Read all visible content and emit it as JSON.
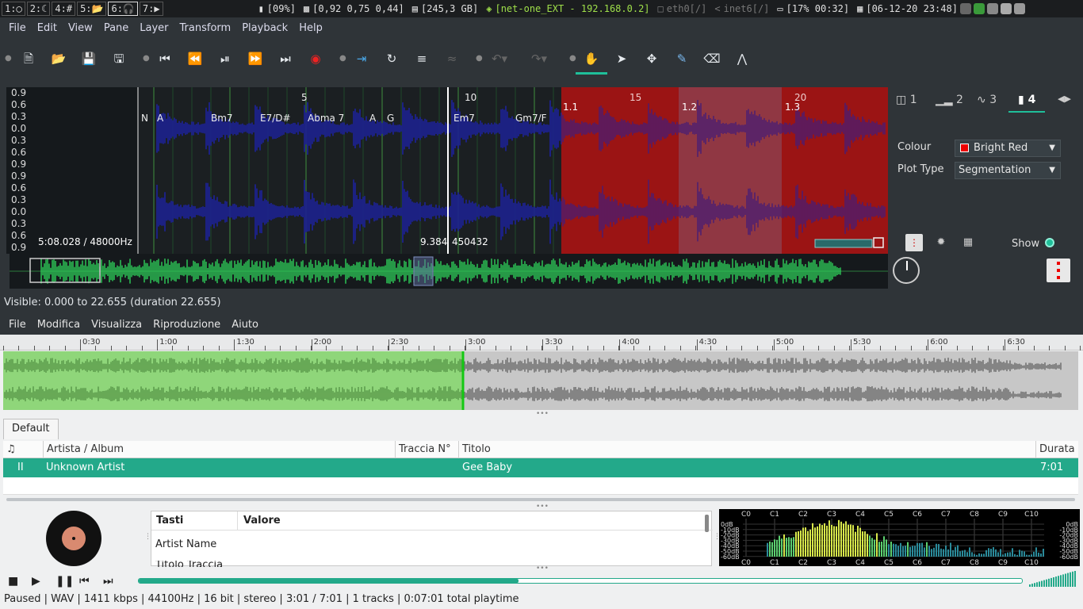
{
  "topbar": {
    "workspaces": [
      "1:",
      "2:",
      "4:#",
      "5:",
      "6:",
      "7:"
    ],
    "battery_pct": "[09%]",
    "load": "[0,92 0,75 0,44]",
    "disk": "[245,3 GB]",
    "wifi": "[net-one_EXT - 192.168.0.2]",
    "eth": "eth0[/]",
    "inet6": "inet6[/]",
    "battery2": "[17% 00:32]",
    "datetime": "[06-12-20 23:48]",
    "colors": {
      "wifi": "#9fe04a",
      "inactive": "#777777"
    }
  },
  "sv": {
    "menu": [
      "File",
      "Edit",
      "View",
      "Pane",
      "Layer",
      "Transform",
      "Playback",
      "Help"
    ],
    "toolbar_icons": [
      "new-file-icon",
      "open-folder-icon",
      "save-icon",
      "save-as-icon",
      "rewind-start-icon",
      "rewind-icon",
      "play-pause-icon",
      "fast-forward-icon",
      "forward-end-icon",
      "record-icon",
      "play-selection-icon",
      "loop-icon",
      "solo-icon",
      "align-icon",
      "undo-icon",
      "redo-icon",
      "navigate-icon",
      "select-icon",
      "move-icon",
      "draw-icon",
      "erase-icon",
      "measure-icon"
    ],
    "y_ticks_top": [
      "0.9",
      "0.6",
      "0.3",
      "0.0",
      "0.3",
      "0.6",
      "0.9"
    ],
    "y_ticks_bottom": [
      "0.9",
      "0.6",
      "0.3",
      "0.0",
      "0.3",
      "0.6",
      "0.9"
    ],
    "bar_numbers": [
      "5",
      "10",
      "15",
      "20"
    ],
    "segment_labels": [
      "1.1",
      "1.2",
      "1.3"
    ],
    "chord_labels": [
      "N",
      "A",
      "Bm7",
      "E7/D#",
      "Abma 7",
      "A",
      "G",
      "Em7",
      "Gm7/F"
    ],
    "position_text": "5:08.028 / 48000Hz",
    "cursor_time": "9.384",
    "cursor_frame": "450432",
    "visible_text": "Visible: 0.000 to 22.655 (duration 22.655)",
    "panel": {
      "tabs": [
        "1",
        "2",
        "3",
        "4"
      ],
      "active_tab": "4",
      "colour_label": "Colour",
      "colour_value": "Bright Red",
      "plot_type_label": "Plot Type",
      "plot_type_value": "Segmentation",
      "show_label": "Show"
    },
    "colors": {
      "waveform": "#1d22a8",
      "segment": "#9c1414",
      "segment_light": "#8a4b5c",
      "overview": "#2fd05a",
      "accent": "#1fbf9a"
    }
  },
  "aud": {
    "menu": [
      "File",
      "Modifica",
      "Visualizza",
      "Riproduzione",
      "Aiuto"
    ],
    "timeline_ticks": [
      "0:30",
      "1:00",
      "1:30",
      "2:00",
      "2:30",
      "3:00",
      "3:30",
      "4:00",
      "4:30",
      "5:00",
      "5:30",
      "6:00",
      "6:30"
    ],
    "playlist_tab": "Default",
    "columns": {
      "icon": "♫",
      "artist": "Artista / Album",
      "track": "Traccia N°",
      "title": "Titolo",
      "duration": "Durata"
    },
    "rows": [
      {
        "state": "II",
        "artist": "Unknown Artist",
        "track": "",
        "title": "Gee Baby",
        "duration": "7:01"
      }
    ],
    "info": {
      "key_header": "Tasti",
      "value_header": "Valore",
      "row1": "Artist Name",
      "row2": "Titolo Traccia"
    },
    "spectrum_top": [
      "C0",
      "C1",
      "C2",
      "C3",
      "C4",
      "C5",
      "C6",
      "C7",
      "C8",
      "C9",
      "C10"
    ],
    "db_left": [
      "0dB",
      "-10dB",
      "-20dB",
      "-30dB",
      "-40dB",
      "-50dB",
      "-60dB"
    ],
    "db_right": [
      "0dB",
      "-10dB",
      "-20dB",
      "-30dB",
      "-40dB",
      "-50dB",
      "-60dB"
    ],
    "progress": 0.43,
    "played_fraction": 0.428,
    "status": "Paused | WAV | 1411 kbps | 44100Hz | 16 bit | stereo | 3:01 / 7:01 | 1 tracks | 0:07:01 total playtime",
    "colors": {
      "accent": "#23a98a",
      "played": "#8fd67a",
      "unplayed": "#c7c7c7"
    }
  }
}
